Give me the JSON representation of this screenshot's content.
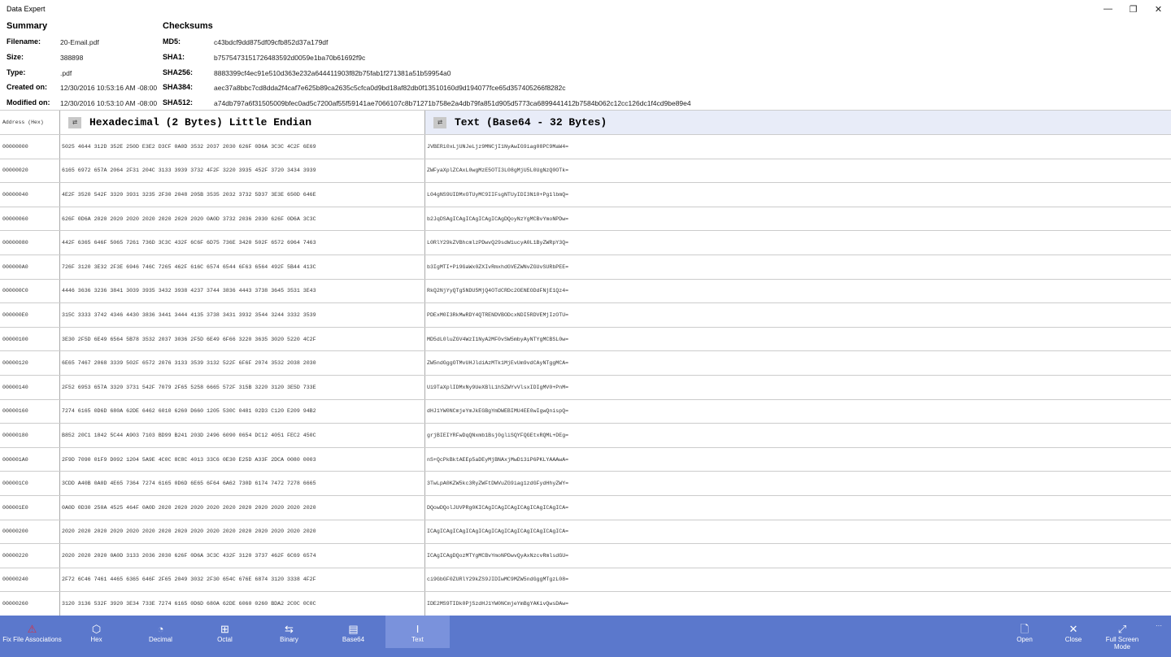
{
  "app": {
    "title": "Data Expert",
    "window_controls": [
      "—",
      "❐",
      "✕"
    ]
  },
  "summary": {
    "heading": "Summary",
    "fields": [
      {
        "label": "Filename:",
        "value": "20-Email.pdf"
      },
      {
        "label": "Size:",
        "value": "388898"
      },
      {
        "label": "Type:",
        "value": ".pdf"
      },
      {
        "label": "Created on:",
        "value": "12/30/2016 10:53:16 AM -08:00"
      },
      {
        "label": "Modified on:",
        "value": "12/30/2016 10:53:10 AM -08:00"
      }
    ]
  },
  "checksums": {
    "heading": "Checksums",
    "fields": [
      {
        "label": "MD5:",
        "value": "c43bdcf9dd875df09cfb852d37a179df"
      },
      {
        "label": "SHA1:",
        "value": "b7575473151726483592d0059e1ba70b61692f9c"
      },
      {
        "label": "SHA256:",
        "value": "8883399cf4ec91e510d363e232a644411903f82b75fab1f271381a51b59954a0"
      },
      {
        "label": "SHA384:",
        "value": "aec37a8bbc7cd8dda2f4caf7e625b89ca2635c5cfca0d9bd18af82db0f13510160d9d194077fce65d357405266f8282c"
      },
      {
        "label": "SHA512:",
        "value": "a74db797a6f31505009bfec0ad5c7200af55f59141ae7066107c8b71271b758e2a4db79fa851d905d5773ca6899441412b7584b062c12cc126dc1f4cd9be89e4"
      }
    ]
  },
  "table": {
    "headers": {
      "address": "Address (Hex)",
      "hex": "Hexadecimal (2 Bytes) Little Endian",
      "text": "Text (Base64 - 32 Bytes)"
    },
    "rows": [
      [
        "00000000",
        "5025 4644 312D 352E 250D E3E2 D3CF 0A0D 3532 2037 2030 626F 0D6A 3C3C 4C2F 6E69",
        "JVBERi0xLjUNJeLjz9MNCjI1NyAwIG9iag08PC9MaW4="
      ],
      [
        "00000020",
        "6165 6972 657A 2064 2F31 204C 3133 3939 3732 4F2F 3220 3935 452F 3720 3434 3939",
        "ZWFyaXplZCAxL0wgMzE5OTI3L08gMjU5L0UgNzQ0OTk="
      ],
      [
        "00000040",
        "4E2F 3520 542F 3320 3931 3235 2F30 2048 205B 3535 2032 3732 5D37 3E3E 650D 646E",
        "L04gNS9UIDMxOTUyMC9IIFsgNTUyIDI3N10+Pg1lbmQ="
      ],
      [
        "00000060",
        "626F 0D6A 2020 2020 2020 2020 2020 2020 2020 0A0D 3732 2036 2030 626F 0D6A 3C3C",
        "b2JqDSAgICAgICAgICAgICAgDQoyNzYgMCBvYmoNPDw="
      ],
      [
        "00000080",
        "442F 6365 646F 5065 7261 736D 3C3C 432F 6C6F 6D75 736E 3420 502F 6572 6964 7463",
        "L0RlY29kZVBhcmlzPDwvQ29sdW1ucyA0L1ByZWRpY3Q="
      ],
      [
        "000000A0",
        "726F 3120 3E32 2F3E 6946 746C 7265 462F 616C 6574 6544 6F63 6564 492F 5B44 413C",
        "b3IgMTI+Pi9GaWx0ZXIvRmxhdGVEZWNvZGUvSURbPEE="
      ],
      [
        "000000C0",
        "4446 3636 3236 3841 3039 3935 3432 3938 4237 3744 3836 4443 3738 3645 3531 3E43",
        "RkQ2NjYyQTg5NDU5MjQ4OTdCRDc2OENEODdFNjE1Qz4="
      ],
      [
        "000000E0",
        "315C 3333 3742 4346 4430 3836 3441 3444 4135 3738 3431 3932 3544 3244 3332 3539",
        "PDExM0I3RkMwRDY4QTRENDVBODcxNDI5RDVEMjIzOTU="
      ],
      [
        "00000100",
        "3E30 2F5D 6E49 6564 5B78 3532 2037 3036 2F5D 6E49 6F66 3220 3635 3020 5220 4C2F",
        "MD5dL0luZGV4WzI1NyA2MF0vSW5mbyAyNTYgMCBSL0w="
      ],
      [
        "00000120",
        "6E65 7467 2068 3339 502F 6572 2076 3133 3539 3132 522F 6F6F 2074 3532 2038 2030",
        "ZW5ndGggOTMvUHJldiAzMTk1MjEvUm9vdCAyNTggMCA="
      ],
      [
        "00000140",
        "2F52 6953 657A 3320 3731 542F 7079 2F65 5258 6665 572F 315B 3220 3120 3E5D 733E",
        "Ui9TaXplIDMxNy9UeXBlL1hSZWYvVlsxIDIgMV0+PnM="
      ],
      [
        "00000160",
        "7274 6165 0D6D 680A 62DE 6462 6010 6260 D660 1205 530C 0481 02D3 C120 E209 94B2",
        "dHJ1YW0NCmjeYmJkEGBgYmDWEBIMU4EE0wIgwQnispQ="
      ],
      [
        "00000180",
        "B852 20C1 1842 5C44 A903 7103 BD99 B241 203D 2496 6090 0654 DC12 4051 FEC2 450C",
        "grjBIEIYRFwDqQNxmb1Bsj0gliSQYFQGEtxRQML+DEg="
      ],
      [
        "000001A0",
        "2F9D 7090 01F9 D092 1204 5A9E 4C0C 8C8C 4013 33C6 0E30 E25D A33F 2DCA 0080 0003",
        "nS+QcPkBktAEEp5aDEyMjBNAxjMwD13iP6PKLYAAAwA="
      ],
      [
        "000001C0",
        "3CDD A40B 0A0D 4E65 7364 7274 6165 0D6D 6E65 6F64 6A62 730D 6174 7472 7278 6665",
        "3TwLpA0KZW5kc3RyZWFtDWVuZG9iag1zdGFydHhyZWY="
      ],
      [
        "000001E0",
        "0A0D 0D30 250A 4525 464F 0A0D 2020 2020 2020 2020 2020 2020 2020 2020 2020 2020",
        "DQowDQolJUVPRg0KICAgICAgICAgICAgICAgICAgICA="
      ],
      [
        "00000200",
        "2020 2020 2020 2020 2020 2020 2020 2020 2020 2020 2020 2020 2020 2020 2020 2020",
        "ICAgICAgICAgICAgICAgICAgICAgICAgICAgICAgICA="
      ],
      [
        "00000220",
        "2020 2020 2020 0A0D 3133 2036 2030 626F 0D6A 3C3C 432F 3120 3737 462F 6C69 6574",
        "ICAgICAgDQozMTYgMCBvYmoNPDwvQyAxNzcvRmlsdGU="
      ],
      [
        "00000240",
        "2F72 6C46 7461 4465 6365 646F 2F65 2049 3032 2F30 654C 676E 6874 3120 3338 4F2F",
        "ci9GbGF0ZURlY29kZS9JIDIwMC9MZW5ndGggMTgzL08="
      ],
      [
        "00000260",
        "3120 3136 532F 3920 3E34 733E 7274 6165 0D6D 680A 62DE 6060 0260 BDA2 2C0C 0C0C",
        "IDE2MS9TIDk0PjSzdHJ1YW0NCmjeYmBgYAKivQwsDAw="
      ]
    ]
  },
  "toolbar": {
    "left": [
      {
        "label": "Fix File Associations",
        "icon": "warning-icon",
        "glyph": "⚠"
      },
      {
        "label": "Hex",
        "icon": "cube-icon",
        "glyph": "⬡"
      },
      {
        "label": "Decimal",
        "icon": "pie-chart-icon",
        "glyph": "◔"
      },
      {
        "label": "Octal",
        "icon": "grid-add-icon",
        "glyph": "⊞"
      },
      {
        "label": "Binary",
        "icon": "sliders-icon",
        "glyph": "⇆"
      },
      {
        "label": "Base64",
        "icon": "table-icon",
        "glyph": "▤"
      },
      {
        "label": "Text",
        "icon": "text-cursor-icon",
        "glyph": "I",
        "active": true
      }
    ],
    "right": [
      {
        "label": "Open",
        "icon": "document-icon",
        "glyph": "🗋"
      },
      {
        "label": "Close",
        "icon": "close-icon",
        "glyph": "✕"
      },
      {
        "label": "Full Screen Mode",
        "icon": "fullscreen-icon",
        "glyph": "⤢"
      }
    ],
    "more": "···"
  },
  "colors": {
    "toolbar": "#5b78cc",
    "toolbar_active": "#7a92dc",
    "warning": "#d0334a",
    "text_header_bg": "#e8ecf8"
  }
}
